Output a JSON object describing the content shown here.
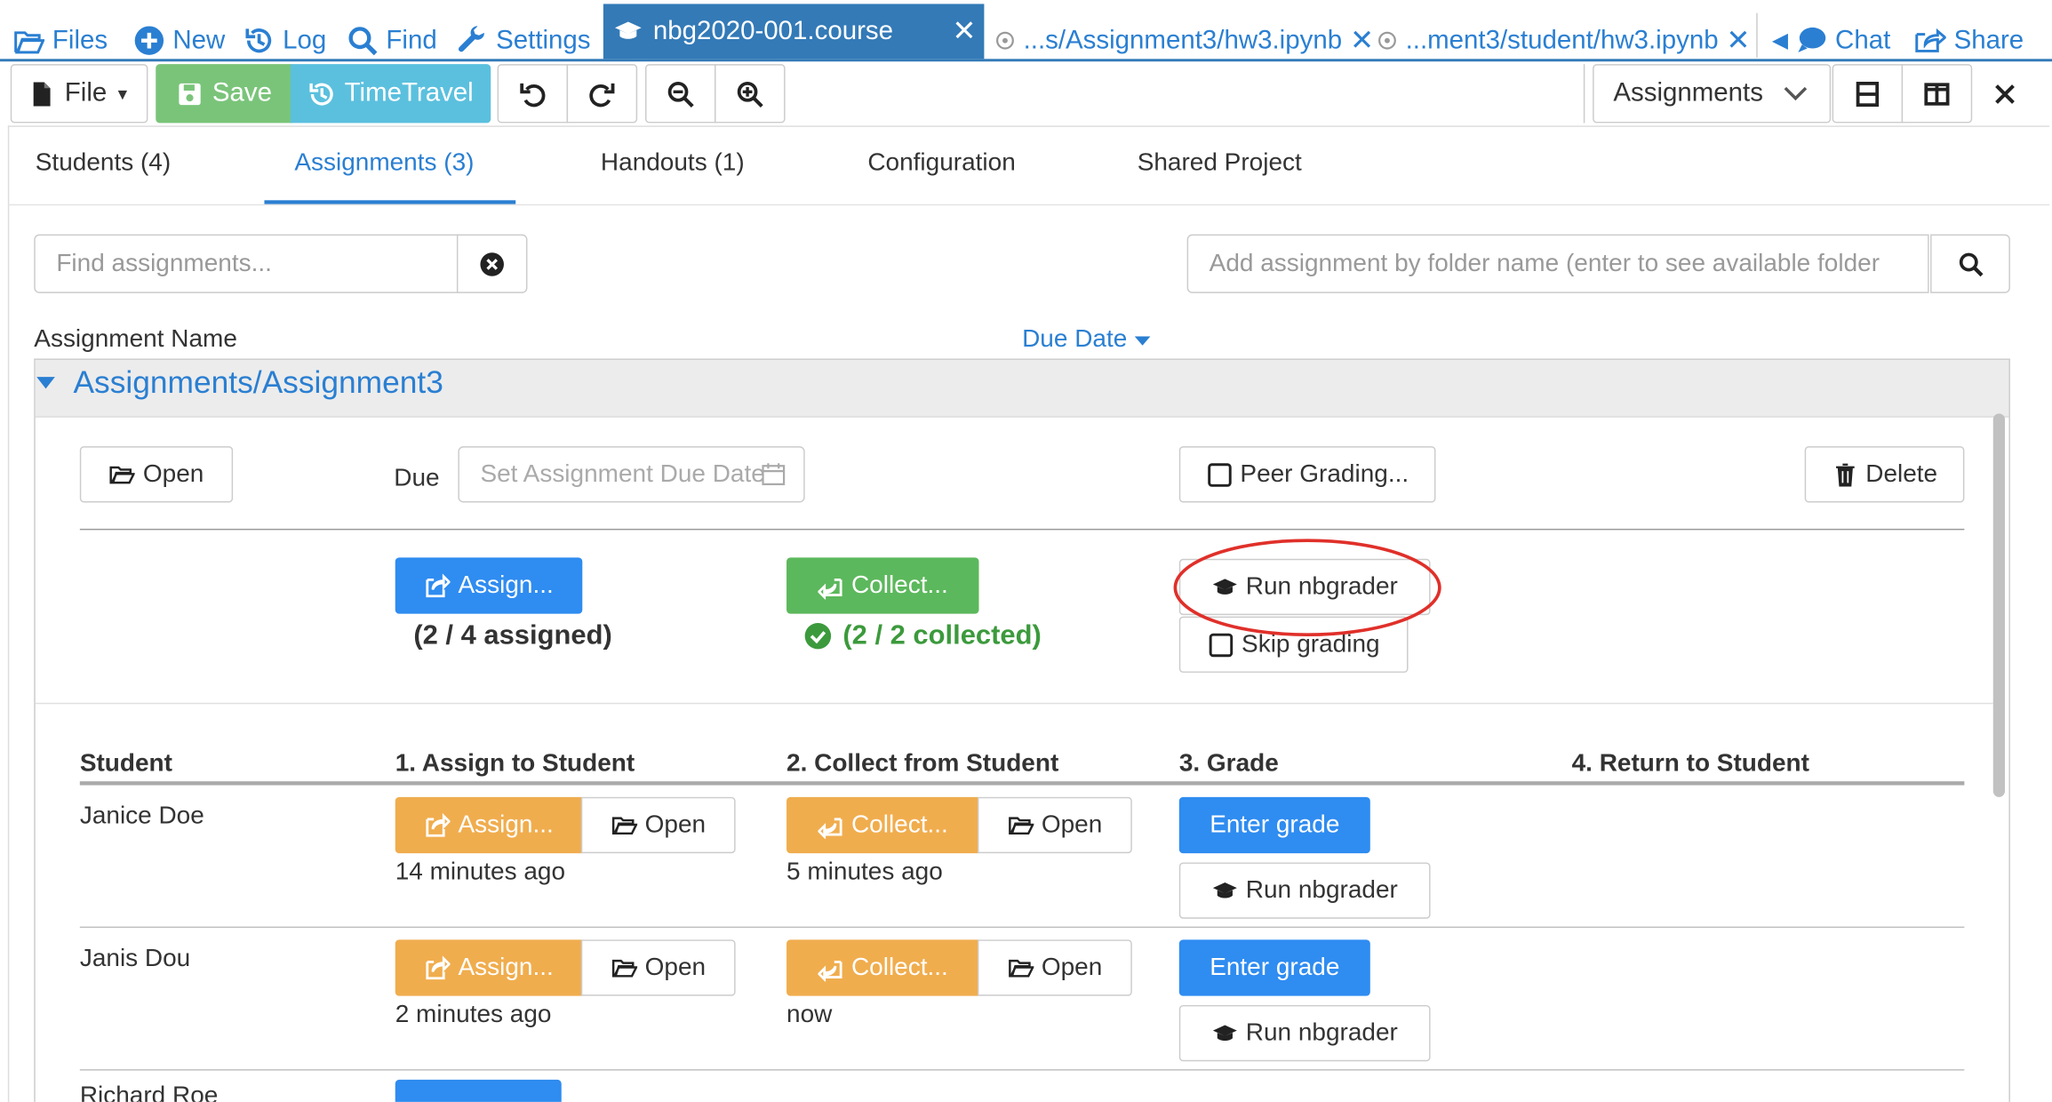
{
  "nav": {
    "files": "Files",
    "new": "New",
    "log": "Log",
    "find": "Find",
    "settings": "Settings",
    "active_tab": "nbg2020-001.course",
    "tab2": "...s/Assignment3/hw3.ipynb",
    "tab3": "...ment3/student/hw3.ipynb",
    "chat": "Chat",
    "share": "Share"
  },
  "toolbar": {
    "file": "File",
    "save": "Save",
    "timetravel": "TimeTravel",
    "view_select": "Assignments"
  },
  "subtabs": {
    "students": "Students (4)",
    "assignments": "Assignments (3)",
    "handouts": "Handouts (1)",
    "configuration": "Configuration",
    "shared_project": "Shared Project"
  },
  "search": {
    "find_placeholder": "Find assignments...",
    "add_placeholder": "Add assignment by folder name (enter to see available folder"
  },
  "table": {
    "col_name": "Assignment Name",
    "col_due": "Due Date"
  },
  "assignment": {
    "title": "Assignments/Assignment3",
    "open": "Open",
    "due_label": "Due",
    "due_placeholder": "Set Assignment Due Date",
    "peer_grading": "Peer Grading...",
    "delete": "Delete",
    "assign": "Assign...",
    "assigned_status": "(2 / 4 assigned)",
    "collect": "Collect...",
    "collected_status": "(2 / 2 collected)",
    "run_nbgrader": "Run nbgrader",
    "skip_grading": "Skip grading"
  },
  "student_table": {
    "headers": [
      "Student",
      "1. Assign to Student",
      "2. Collect from Student",
      "3. Grade",
      "4. Return to Student"
    ],
    "rows": [
      {
        "name": "Janice Doe",
        "assign": "Assign...",
        "open": "Open",
        "assign_time": "14 minutes ago",
        "collect": "Collect...",
        "collect_open": "Open",
        "collect_time": "5 minutes ago",
        "enter_grade": "Enter grade",
        "run": "Run nbgrader"
      },
      {
        "name": "Janis Dou",
        "assign": "Assign...",
        "open": "Open",
        "assign_time": "2 minutes ago",
        "collect": "Collect...",
        "collect_open": "Open",
        "collect_time": "now",
        "enter_grade": "Enter grade",
        "run": "Run nbgrader"
      },
      {
        "name": "Richard Roe"
      }
    ]
  },
  "colors": {
    "link": "#2a7fd2",
    "primary": "#2f8cf0",
    "success": "#5cb85c",
    "warning": "#f0ad4e",
    "active_tab": "#337ab7",
    "highlight_circle": "#e0302a"
  }
}
